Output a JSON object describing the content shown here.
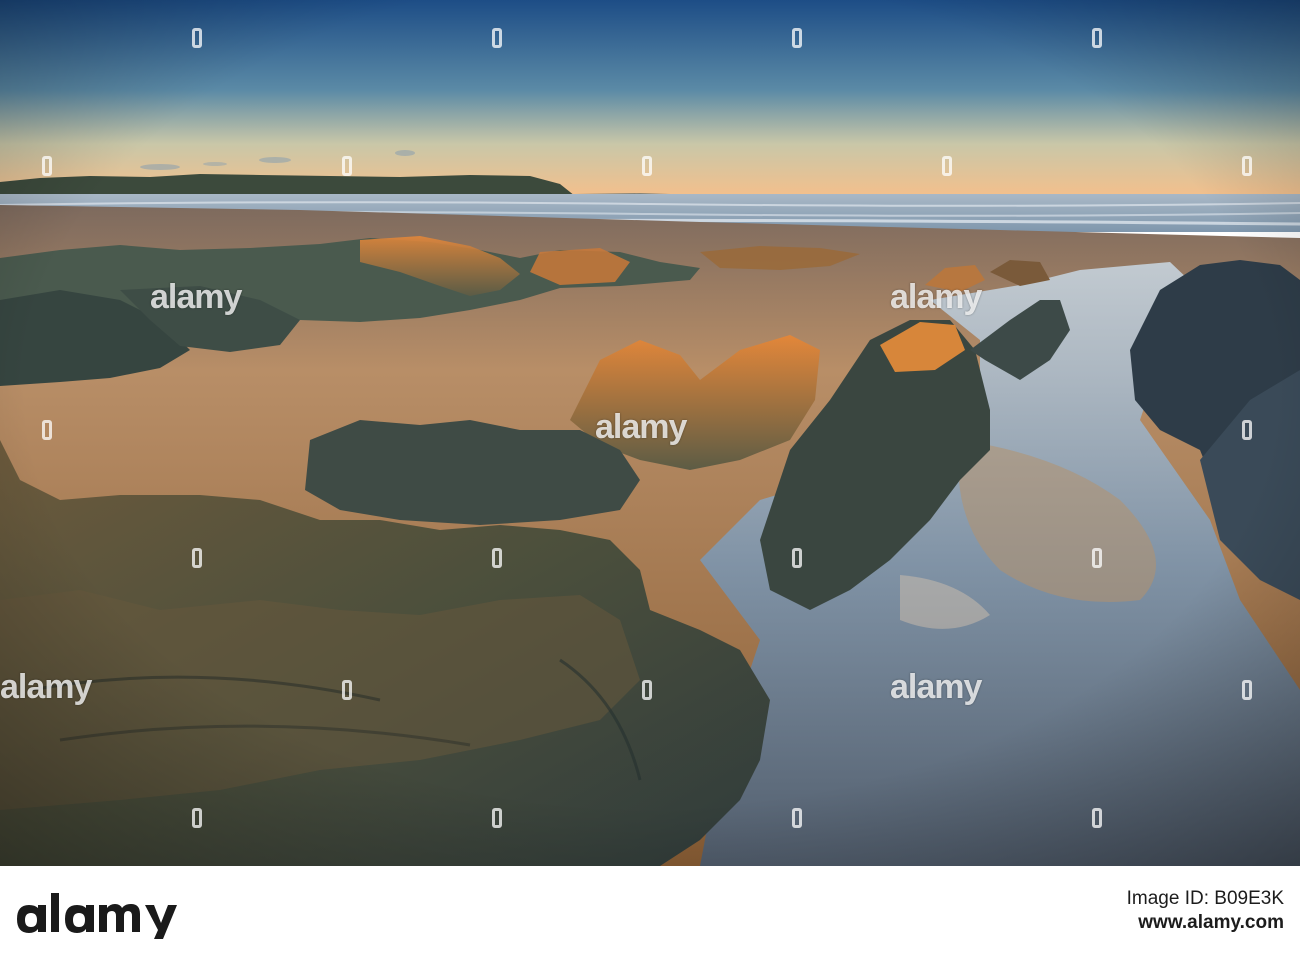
{
  "watermark": {
    "brand": "alamy",
    "text": "alamy"
  },
  "footer": {
    "logo_text": "alamy",
    "image_id_label": "Image ID: B09E3K",
    "site": "www.alamy.com"
  },
  "colors": {
    "sky_top": "#1f4f8a",
    "sky_horizon": "#f6c08a",
    "sand": "#b08257",
    "rock": "#3c4a44",
    "rock_lit": "#d97a2a",
    "water": "#5f7f9c"
  }
}
